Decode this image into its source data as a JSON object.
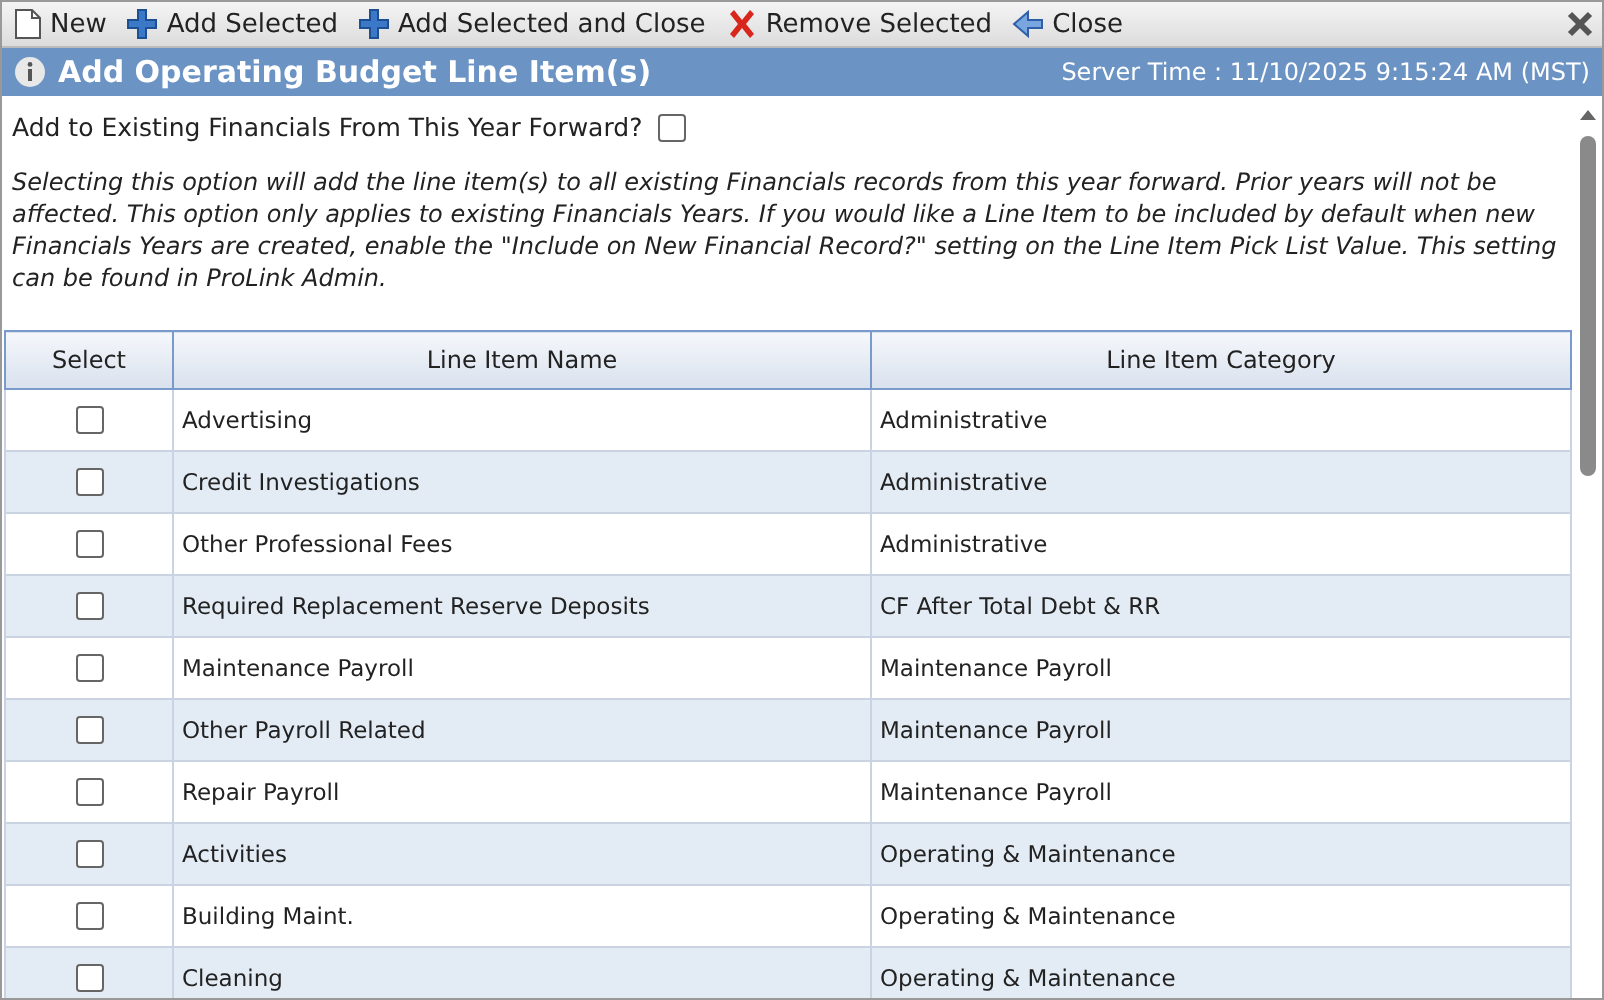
{
  "toolbar": [
    {
      "kind": "new",
      "label": "New"
    },
    {
      "kind": "add",
      "label": "Add Selected"
    },
    {
      "kind": "add",
      "label": "Add Selected and Close"
    },
    {
      "kind": "remove",
      "label": "Remove Selected"
    },
    {
      "kind": "back",
      "label": "Close"
    }
  ],
  "header": {
    "title": "Add Operating Budget Line Item(s)",
    "server_time": "Server Time : 11/10/2025 9:15:24 AM (MST)"
  },
  "forward_option": {
    "label": "Add to Existing Financials From This Year Forward?",
    "checked": false
  },
  "note": "Selecting this option will add the line item(s) to all existing Financials records from this year forward. Prior years will not be affected. This option only applies to existing Financials Years. If you would like a Line Item to be included by default when new Financials Years are created, enable the \"Include on New Financial Record?\" setting on the Line Item Pick List Value. This setting can be found in ProLink Admin.",
  "table": {
    "columns": [
      "Select",
      "Line Item Name",
      "Line Item Category"
    ],
    "rows": [
      {
        "name": "Advertising",
        "category": "Administrative",
        "checked": false
      },
      {
        "name": "Credit Investigations",
        "category": "Administrative",
        "checked": false
      },
      {
        "name": "Other Professional Fees",
        "category": "Administrative",
        "checked": false
      },
      {
        "name": "Required Replacement Reserve Deposits",
        "category": "CF After Total Debt & RR",
        "checked": false
      },
      {
        "name": "Maintenance Payroll",
        "category": "Maintenance Payroll",
        "checked": false
      },
      {
        "name": "Other Payroll Related",
        "category": "Maintenance Payroll",
        "checked": false
      },
      {
        "name": "Repair Payroll",
        "category": "Maintenance Payroll",
        "checked": false
      },
      {
        "name": "Activities",
        "category": "Operating & Maintenance",
        "checked": false
      },
      {
        "name": "Building Maint.",
        "category": "Operating & Maintenance",
        "checked": false
      },
      {
        "name": "Cleaning",
        "category": "Operating & Maintenance",
        "checked": false
      }
    ]
  }
}
